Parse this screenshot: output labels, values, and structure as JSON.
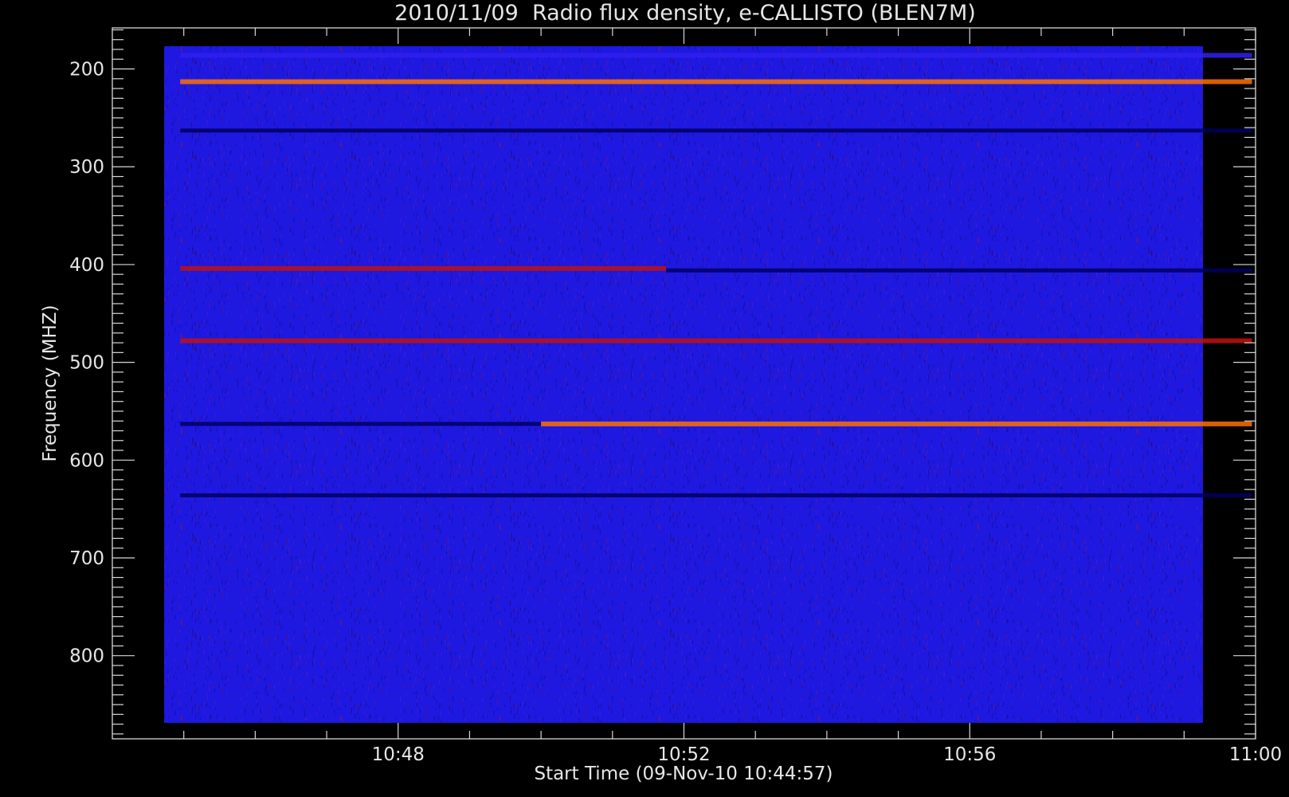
{
  "chart_data": {
    "type": "heatmap",
    "title": "2010/11/09  Radio flux density, e-CALLISTO (BLEN7M)",
    "xlabel": "Start Time (09-Nov-10 10:44:57)",
    "ylabel": "Frequency (MHZ)",
    "x_range": [
      "10:44:57",
      "10:59:57"
    ],
    "xlim": [
      "10:44:00",
      "11:00:00"
    ],
    "x_ticks": [
      "10:48",
      "10:52",
      "10:56",
      "11:00"
    ],
    "ylim": [
      885,
      158
    ],
    "y_range": [
      875,
      175
    ],
    "y_ticks": [
      200,
      300,
      400,
      500,
      600,
      700,
      800
    ],
    "colormap": [
      "#000060",
      "#1010e0",
      "#3020f0",
      "#c01010",
      "#ff7000",
      "#ffffe0"
    ],
    "bands": [
      {
        "freq": 186,
        "start": "10:44:57",
        "end": "10:59:57",
        "intensity": 0.55
      },
      {
        "freq": 213,
        "start": "10:44:57",
        "end": "10:59:57",
        "intensity": 0.85
      },
      {
        "freq": 263,
        "start": "10:44:57",
        "end": "10:59:57",
        "intensity": 0.1
      },
      {
        "freq": 404,
        "start": "10:44:57",
        "end": "10:51:45",
        "intensity": 0.6
      },
      {
        "freq": 406,
        "start": "10:51:45",
        "end": "10:59:57",
        "intensity": 0.05
      },
      {
        "freq": 478,
        "start": "10:44:57",
        "end": "10:59:57",
        "intensity": 0.7
      },
      {
        "freq": 563,
        "start": "10:44:57",
        "end": "10:50:00",
        "intensity": 0.02
      },
      {
        "freq": 563,
        "start": "10:50:00",
        "end": "10:59:57",
        "intensity": 0.9
      },
      {
        "freq": 636,
        "start": "10:44:57",
        "end": "10:59:57",
        "intensity": 0.1
      }
    ]
  }
}
